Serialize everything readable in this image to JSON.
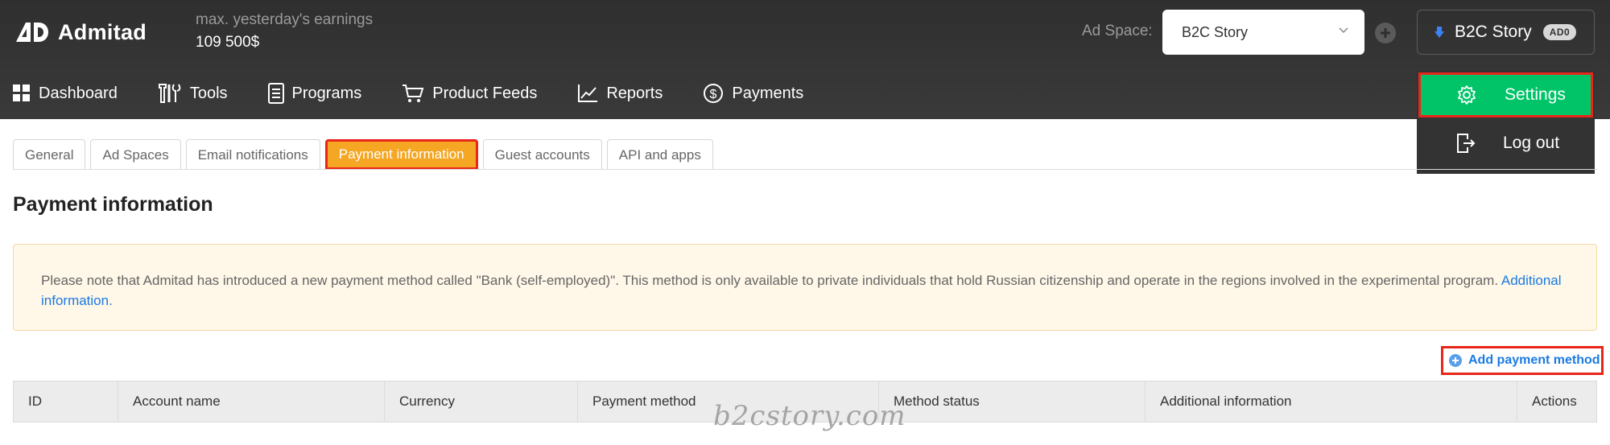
{
  "brand": {
    "name": "Admitad"
  },
  "earnings": {
    "label": "max. yesterday's earnings",
    "value": "109 500$"
  },
  "ad_space": {
    "label": "Ad Space:",
    "selected": "B2C Story"
  },
  "user": {
    "name": "B2C Story",
    "badge": "AD0"
  },
  "nav": [
    {
      "label": "Dashboard",
      "icon": "grid-icon"
    },
    {
      "label": "Tools",
      "icon": "tools-icon"
    },
    {
      "label": "Programs",
      "icon": "document-icon"
    },
    {
      "label": "Product Feeds",
      "icon": "cart-icon"
    },
    {
      "label": "Reports",
      "icon": "chart-icon"
    },
    {
      "label": "Payments",
      "icon": "dollar-icon"
    }
  ],
  "user_menu": {
    "settings": "Settings",
    "logout": "Log out"
  },
  "tabs": [
    {
      "label": "General"
    },
    {
      "label": "Ad Spaces"
    },
    {
      "label": "Email notifications"
    },
    {
      "label": "Payment information",
      "active": true
    },
    {
      "label": "Guest accounts"
    },
    {
      "label": "API and apps"
    }
  ],
  "page_title": "Payment information",
  "notice": {
    "text": "Please note that Admitad has introduced a new payment method called \"Bank (self-employed)\". This method is only available to private individuals that hold Russian citizenship and operate in the regions involved in the experimental program. ",
    "link": "Additional information."
  },
  "add_method_label": "Add payment method",
  "table": {
    "columns": [
      "ID",
      "Account name",
      "Currency",
      "Payment method",
      "Method status",
      "Additional information",
      "Actions"
    ]
  },
  "watermark": "b2cstory.com",
  "colors": {
    "accent_green": "#00c467",
    "highlight_red": "#e8261a",
    "tab_active": "#f5a623",
    "link_blue": "#1a7be0"
  }
}
